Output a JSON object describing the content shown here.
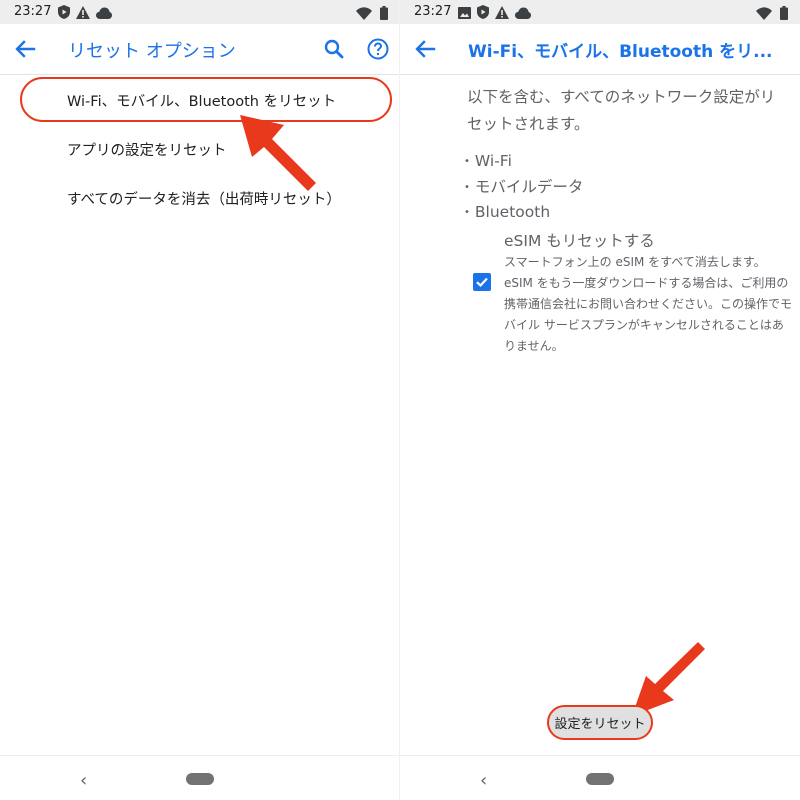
{
  "left_screen": {
    "status_bar": {
      "time": "23:27",
      "icons": [
        "shield-play-icon",
        "alert-triangle-icon",
        "cloud-icon",
        "wifi-icon",
        "battery-icon"
      ]
    },
    "app_bar": {
      "title": "リセット オプション",
      "back_icon": "arrow-back-icon",
      "search_icon": "search-icon",
      "help_icon": "help-circle-icon"
    },
    "menu_items": [
      "Wi-Fi、モバイル、Bluetooth をリセット",
      "アプリの設定をリセット",
      "すべてのデータを消去（出荷時リセット）"
    ],
    "nav_bar": {
      "back": "‹"
    }
  },
  "right_screen": {
    "status_bar": {
      "time": "23:27",
      "icons": [
        "image-icon",
        "shield-play-icon",
        "alert-triangle-icon",
        "cloud-icon",
        "wifi-icon",
        "battery-icon"
      ]
    },
    "app_bar": {
      "title": "Wi-Fi、モバイル、Bluetooth をリ...",
      "back_icon": "arrow-back-icon"
    },
    "description": "以下を含む、すべてのネットワーク設定がリセットされます。",
    "bullets": [
      "Wi-Fi",
      "モバイルデータ",
      "Bluetooth"
    ],
    "esim_option": {
      "title": "eSIM もリセットする",
      "checked": true,
      "description": "スマートフォン上の eSIM をすべて消去します。eSIM をもう一度ダウンロードする場合は、ご利用の携帯通信会社にお問い合わせください。この操作でモバイル サービスプランがキャンセルされることはありません。"
    },
    "reset_button": "設定をリセット",
    "nav_bar": {
      "back": "‹"
    }
  },
  "colors": {
    "accent": "#1a73e8",
    "annotation": "#e8391d",
    "status_bar": "#eeeeee"
  }
}
